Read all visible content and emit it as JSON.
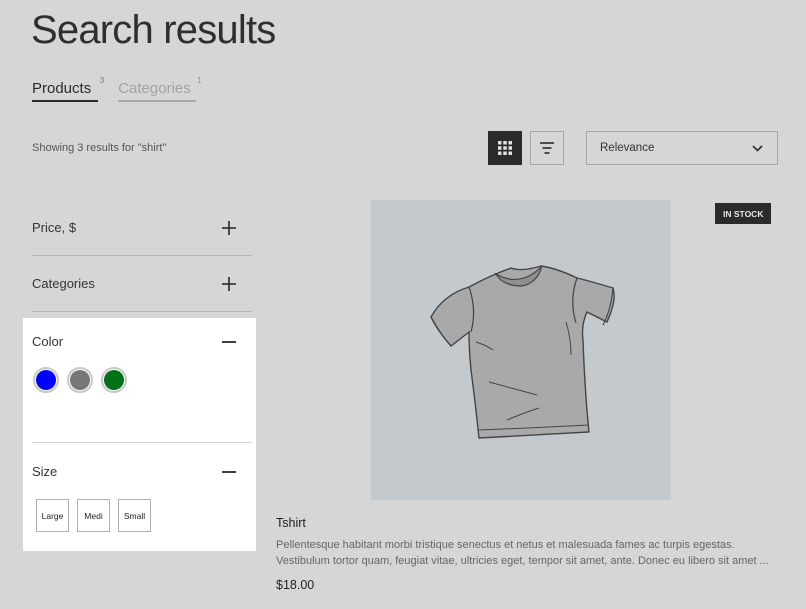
{
  "header": {
    "title": "Search results"
  },
  "tabs": [
    {
      "label": "Products",
      "count": "3",
      "active": true
    },
    {
      "label": "Categories",
      "count": "1",
      "active": false
    }
  ],
  "results": {
    "summary": "Showing 3 results for \"shirt\""
  },
  "toolbar": {
    "grid_view_icon": "grid-icon",
    "list_view_icon": "filter-lines-icon",
    "sort": {
      "selected": "Relevance",
      "icon": "chevron-down-icon"
    }
  },
  "filters": {
    "collapsed": [
      {
        "label": "Price, $",
        "icon": "plus-icon"
      },
      {
        "label": "Categories",
        "icon": "plus-icon"
      }
    ],
    "color": {
      "label": "Color",
      "icon": "minus-icon",
      "swatches": [
        {
          "name": "blue",
          "hex": "#0000ff"
        },
        {
          "name": "gray",
          "hex": "#777777"
        },
        {
          "name": "green",
          "hex": "#007319"
        }
      ]
    },
    "size": {
      "label": "Size",
      "icon": "minus-icon",
      "options": [
        "Large",
        "Medi",
        "Small"
      ]
    }
  },
  "product": {
    "badge": "IN STOCK",
    "name": "Tshirt",
    "description": "Pellentesque habitant morbi tristique senectus et netus et malesuada fames ac turpis egestas. Vestibulum tortor quam, feugiat vitae, ultricies eget, tempor sit amet, ante. Donec eu libero sit amet ...",
    "price": "$18.00",
    "image_alt": "t-shirt illustration"
  }
}
